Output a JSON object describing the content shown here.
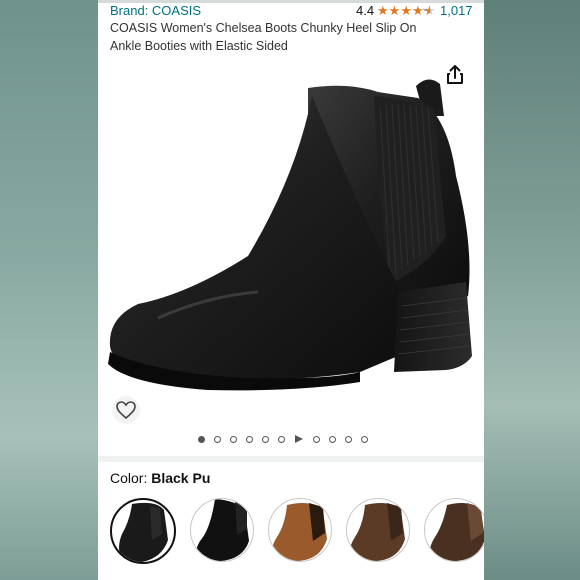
{
  "product": {
    "brand": "Brand: COASIS",
    "rating": "4.4",
    "rating_count": "1,017",
    "title": "COASIS Women's Chelsea Boots Chunky Heel Slip On Ankle Booties with Elastic Sided"
  },
  "gallery": {
    "dot_count": 11,
    "active_index": 0,
    "video_index": 6
  },
  "color": {
    "label": "Color: ",
    "selected": "Black Pu",
    "swatches": [
      {
        "name": "black-pu",
        "color": "#1a1a1a"
      },
      {
        "name": "black-suede",
        "color": "#111111"
      },
      {
        "name": "brown",
        "color": "#9a5a2c"
      },
      {
        "name": "dark-brown",
        "color": "#5c3b26"
      },
      {
        "name": "brown-5",
        "color": "#4a3020"
      }
    ]
  },
  "icons": {
    "share": "share-icon",
    "wishlist": "heart-icon"
  }
}
